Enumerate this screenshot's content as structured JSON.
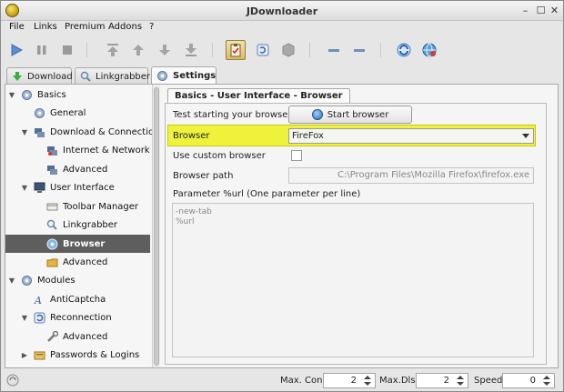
{
  "window": {
    "title": "JDownloader"
  },
  "menu": [
    "File",
    "Links",
    "Premium",
    "Addons",
    "?"
  ],
  "tabs": [
    {
      "label": "Download",
      "icon": "download-icon"
    },
    {
      "label": "Linkgrabber",
      "icon": "linkgrabber-icon"
    },
    {
      "label": "Settings",
      "icon": "settings-icon",
      "active": true
    }
  ],
  "tree": [
    {
      "label": "Basics",
      "icon": "gear-icon",
      "expanded": true
    },
    {
      "label": "General",
      "icon": "gear-icon"
    },
    {
      "label": "Download & Connections",
      "icon": "network-icon",
      "expanded": true
    },
    {
      "label": "Internet & Network",
      "icon": "network-icon"
    },
    {
      "label": "Advanced",
      "icon": "network-icon"
    },
    {
      "label": "User Interface",
      "icon": "monitor-icon",
      "expanded": true
    },
    {
      "label": "Toolbar Manager",
      "icon": "toolbar-icon"
    },
    {
      "label": "Linkgrabber",
      "icon": "linkgrabber-icon"
    },
    {
      "label": "Browser",
      "icon": "browser-icon",
      "selected": true
    },
    {
      "label": "Advanced",
      "icon": "folder-icon"
    },
    {
      "label": "Modules",
      "icon": "gear-icon",
      "expanded": true
    },
    {
      "label": "AntiCaptcha",
      "icon": "captcha-icon"
    },
    {
      "label": "Reconnection",
      "icon": "reconnect-icon",
      "expanded": true
    },
    {
      "label": "Advanced",
      "icon": "wrench-icon"
    },
    {
      "label": "Passwords & Logins",
      "icon": "passwords-icon",
      "expanded": false
    }
  ],
  "panel": {
    "tab_title": "Basics - User Interface - Browser",
    "test_label": "Test starting your browser",
    "start_button": "Start browser",
    "browser_label": "Browser",
    "browser_value": "FireFox",
    "custom_label": "Use custom browser",
    "path_label": "Browser path",
    "path_value": "C:\\Program Files\\Mozilla Firefox\\firefox.exe",
    "param_label": "Parameter %url (One parameter per line)",
    "param_value": "-new-tab\n%url"
  },
  "status": {
    "max_con_label": "Max. Con.",
    "max_con": "2",
    "max_dls_label": "Max.Dls.",
    "max_dls": "2",
    "speed_label": "Speed",
    "speed": "0"
  },
  "colors": {
    "highlight": "#eef23a",
    "selected_row": "#5e5e5e"
  }
}
